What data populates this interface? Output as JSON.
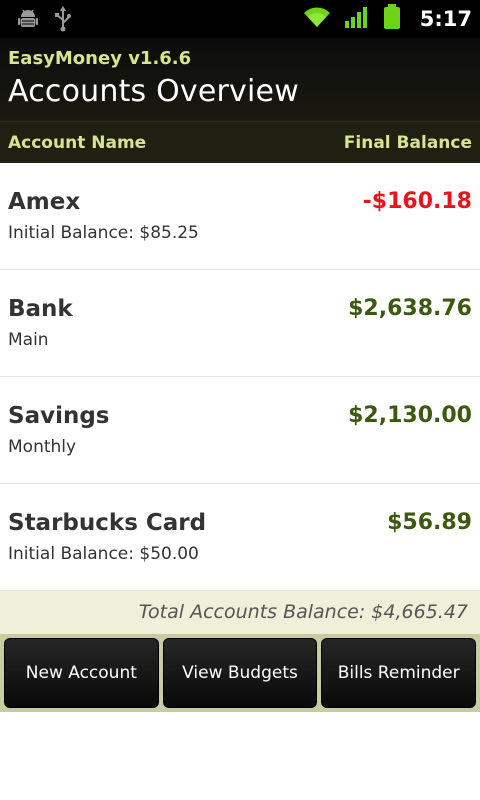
{
  "status_bar": {
    "time": "5:17",
    "icons": [
      "android-debug-icon",
      "usb-icon",
      "wifi-icon",
      "signal-icon",
      "battery-icon"
    ]
  },
  "header": {
    "app_name": "EasyMoney v1.6.6",
    "title": "Accounts Overview"
  },
  "columns": {
    "name": "Account Name",
    "balance": "Final Balance"
  },
  "accounts": [
    {
      "name": "Amex",
      "subtitle": "Initial Balance: $85.25",
      "balance": "-$160.18"
    },
    {
      "name": "Bank",
      "subtitle": "Main",
      "balance": "$2,638.76"
    },
    {
      "name": "Savings",
      "subtitle": "Monthly",
      "balance": "$2,130.00"
    },
    {
      "name": "Starbucks Card",
      "subtitle": "Initial Balance: $50.00",
      "balance": "$56.89"
    }
  ],
  "total": "Total Accounts Balance: $4,665.47",
  "buttons": {
    "new_account": "New Account",
    "view_budgets": "View Budgets",
    "bills_reminder": "Bills Reminder"
  },
  "colors": {
    "negative": "#e8141c",
    "positive": "#3c5a0f",
    "accent": "#d6e58e"
  }
}
